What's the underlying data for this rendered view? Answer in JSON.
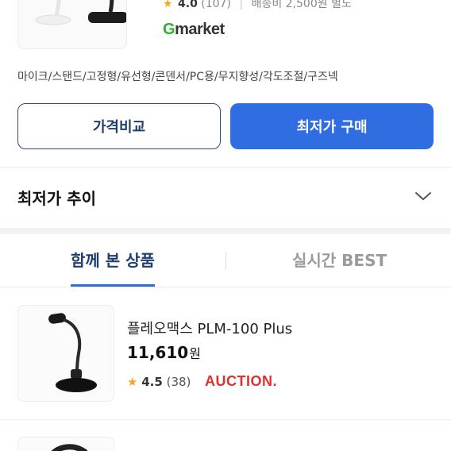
{
  "top_product": {
    "rating": "4.0",
    "review_count": "(107)",
    "shipping": "배송비 2,500원 별도",
    "store_logo_text_g": "G",
    "store_logo_text_rest": "market"
  },
  "tags": "마이크/스탠드/고정형/유선형/콘덴서/PC용/무지향성/각도조절/구즈넥",
  "buttons": {
    "compare_label": "가격비교",
    "buy_label": "최저가 구매"
  },
  "price_trend": {
    "title": "최저가 추이"
  },
  "tabs": [
    {
      "label": "함께 본 상품",
      "active": true
    },
    {
      "label": "실시간 BEST",
      "active": false
    }
  ],
  "products": [
    {
      "name": "플레오맥스 PLM-100 Plus",
      "price": "11,610",
      "currency": "원",
      "rating": "4.5",
      "review_count": "(38)",
      "store": "AUCTION."
    }
  ],
  "colors": {
    "primary": "#2f6de1",
    "navy": "#1f3d6e",
    "star": "#f4a623",
    "gmarket_green": "#2eb135",
    "auction_red": "#e0302d"
  }
}
